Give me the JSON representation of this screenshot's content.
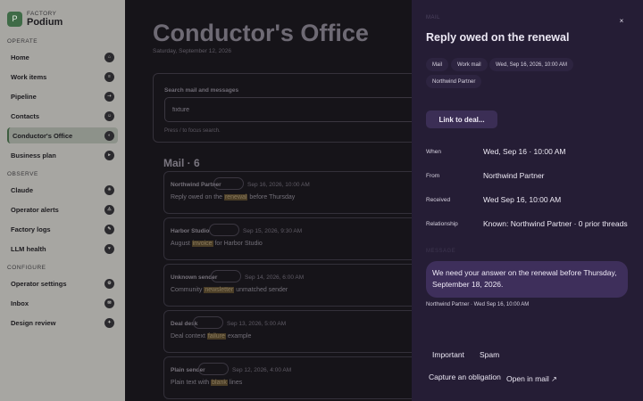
{
  "brand": {
    "kicker": "FACTORY",
    "name": "Podium",
    "logo_letter": "P",
    "accent": "#3f6b47"
  },
  "sidebar": {
    "sections": [
      {
        "label": "OPERATE",
        "items": [
          {
            "label": "Home",
            "icon": "home-icon",
            "glyph": "⌂"
          },
          {
            "label": "Work items",
            "icon": "list-icon",
            "glyph": "≡"
          },
          {
            "label": "Pipeline",
            "icon": "pipeline-icon",
            "glyph": "⇢"
          },
          {
            "label": "Contacts",
            "icon": "contacts-icon",
            "glyph": "☺"
          },
          {
            "label": "Conductor's Office",
            "icon": "office-icon",
            "glyph": "◐",
            "active": true
          },
          {
            "label": "Business plan",
            "icon": "plan-icon",
            "glyph": "▸"
          }
        ]
      },
      {
        "label": "OBSERVE",
        "items": [
          {
            "label": "Claude",
            "icon": "claude-icon",
            "glyph": "✳"
          },
          {
            "label": "Operator alerts",
            "icon": "alert-icon",
            "glyph": "⚠"
          },
          {
            "label": "Factory logs",
            "icon": "logs-icon",
            "glyph": "✎"
          },
          {
            "label": "LLM health",
            "icon": "health-icon",
            "glyph": "♥"
          }
        ]
      },
      {
        "label": "CONFIGURE",
        "items": [
          {
            "label": "Operator settings",
            "icon": "settings-icon",
            "glyph": "⚙"
          },
          {
            "label": "Inbox",
            "icon": "inbox-icon",
            "glyph": "✉"
          },
          {
            "label": "Design review",
            "icon": "design-icon",
            "glyph": "✦"
          }
        ]
      }
    ]
  },
  "main": {
    "title": "Conductor's Office",
    "date": "Saturday, September 12, 2026",
    "search": {
      "label": "Search mail and messages",
      "value": "fixture",
      "hint": "Press / to focus search."
    },
    "mail_heading": "Mail · 6",
    "mail": [
      {
        "sender": "Northwind Partner",
        "time": "Sep 16, 2026, 10:00 AM",
        "pre": "Reply owed on the ",
        "hit": "renewal",
        "post": " before Thursday"
      },
      {
        "sender": "Harbor Studio",
        "time": "Sep 15, 2026, 9:30 AM",
        "pre": "August ",
        "hit": "invoice",
        "post": " for Harbor Studio"
      },
      {
        "sender": "Unknown sender",
        "time": "Sep 14, 2026, 6:00 AM",
        "pre": "Community ",
        "hit": "newsletter",
        "post": " unmatched sender"
      },
      {
        "sender": "Deal desk",
        "time": "Sep 13, 2026, 5:00 AM",
        "pre": "Deal context ",
        "hit": "failure",
        "post": " example"
      },
      {
        "sender": "Plain sender",
        "time": "Sep 12, 2026, 4:00 AM",
        "pre": "Plain text with ",
        "hit": "blank",
        "post": " lines"
      }
    ]
  },
  "drawer": {
    "kicker": "MAIL",
    "title": "Reply owed on the renewal",
    "chips": [
      "Mail",
      "Work mail",
      "Wed, Sep 16, 2026, 10:00 AM",
      "Northwind Partner"
    ],
    "link_button": "Link to deal...",
    "fields": [
      {
        "label": "When",
        "value": "Wed, Sep 16 · 10:00 AM"
      },
      {
        "label": "From",
        "value": "Northwind Partner"
      },
      {
        "label": "Received",
        "value": "Wed Sep 16, 10:00 AM"
      },
      {
        "label": "Relationship",
        "value": "Known: Northwind Partner · 0 prior threads"
      }
    ],
    "message_section": "MESSAGE",
    "message": "We need your answer on the renewal before Thursday, September 18, 2026.",
    "message_meta": "Northwind Partner · Wed Sep 16, 10:00 AM",
    "actions": {
      "important": "Important",
      "spam": "Spam",
      "capture": "Capture an obligation",
      "open": "Open in mail",
      "open_glyph": "↗",
      "close_glyph": "×"
    }
  }
}
